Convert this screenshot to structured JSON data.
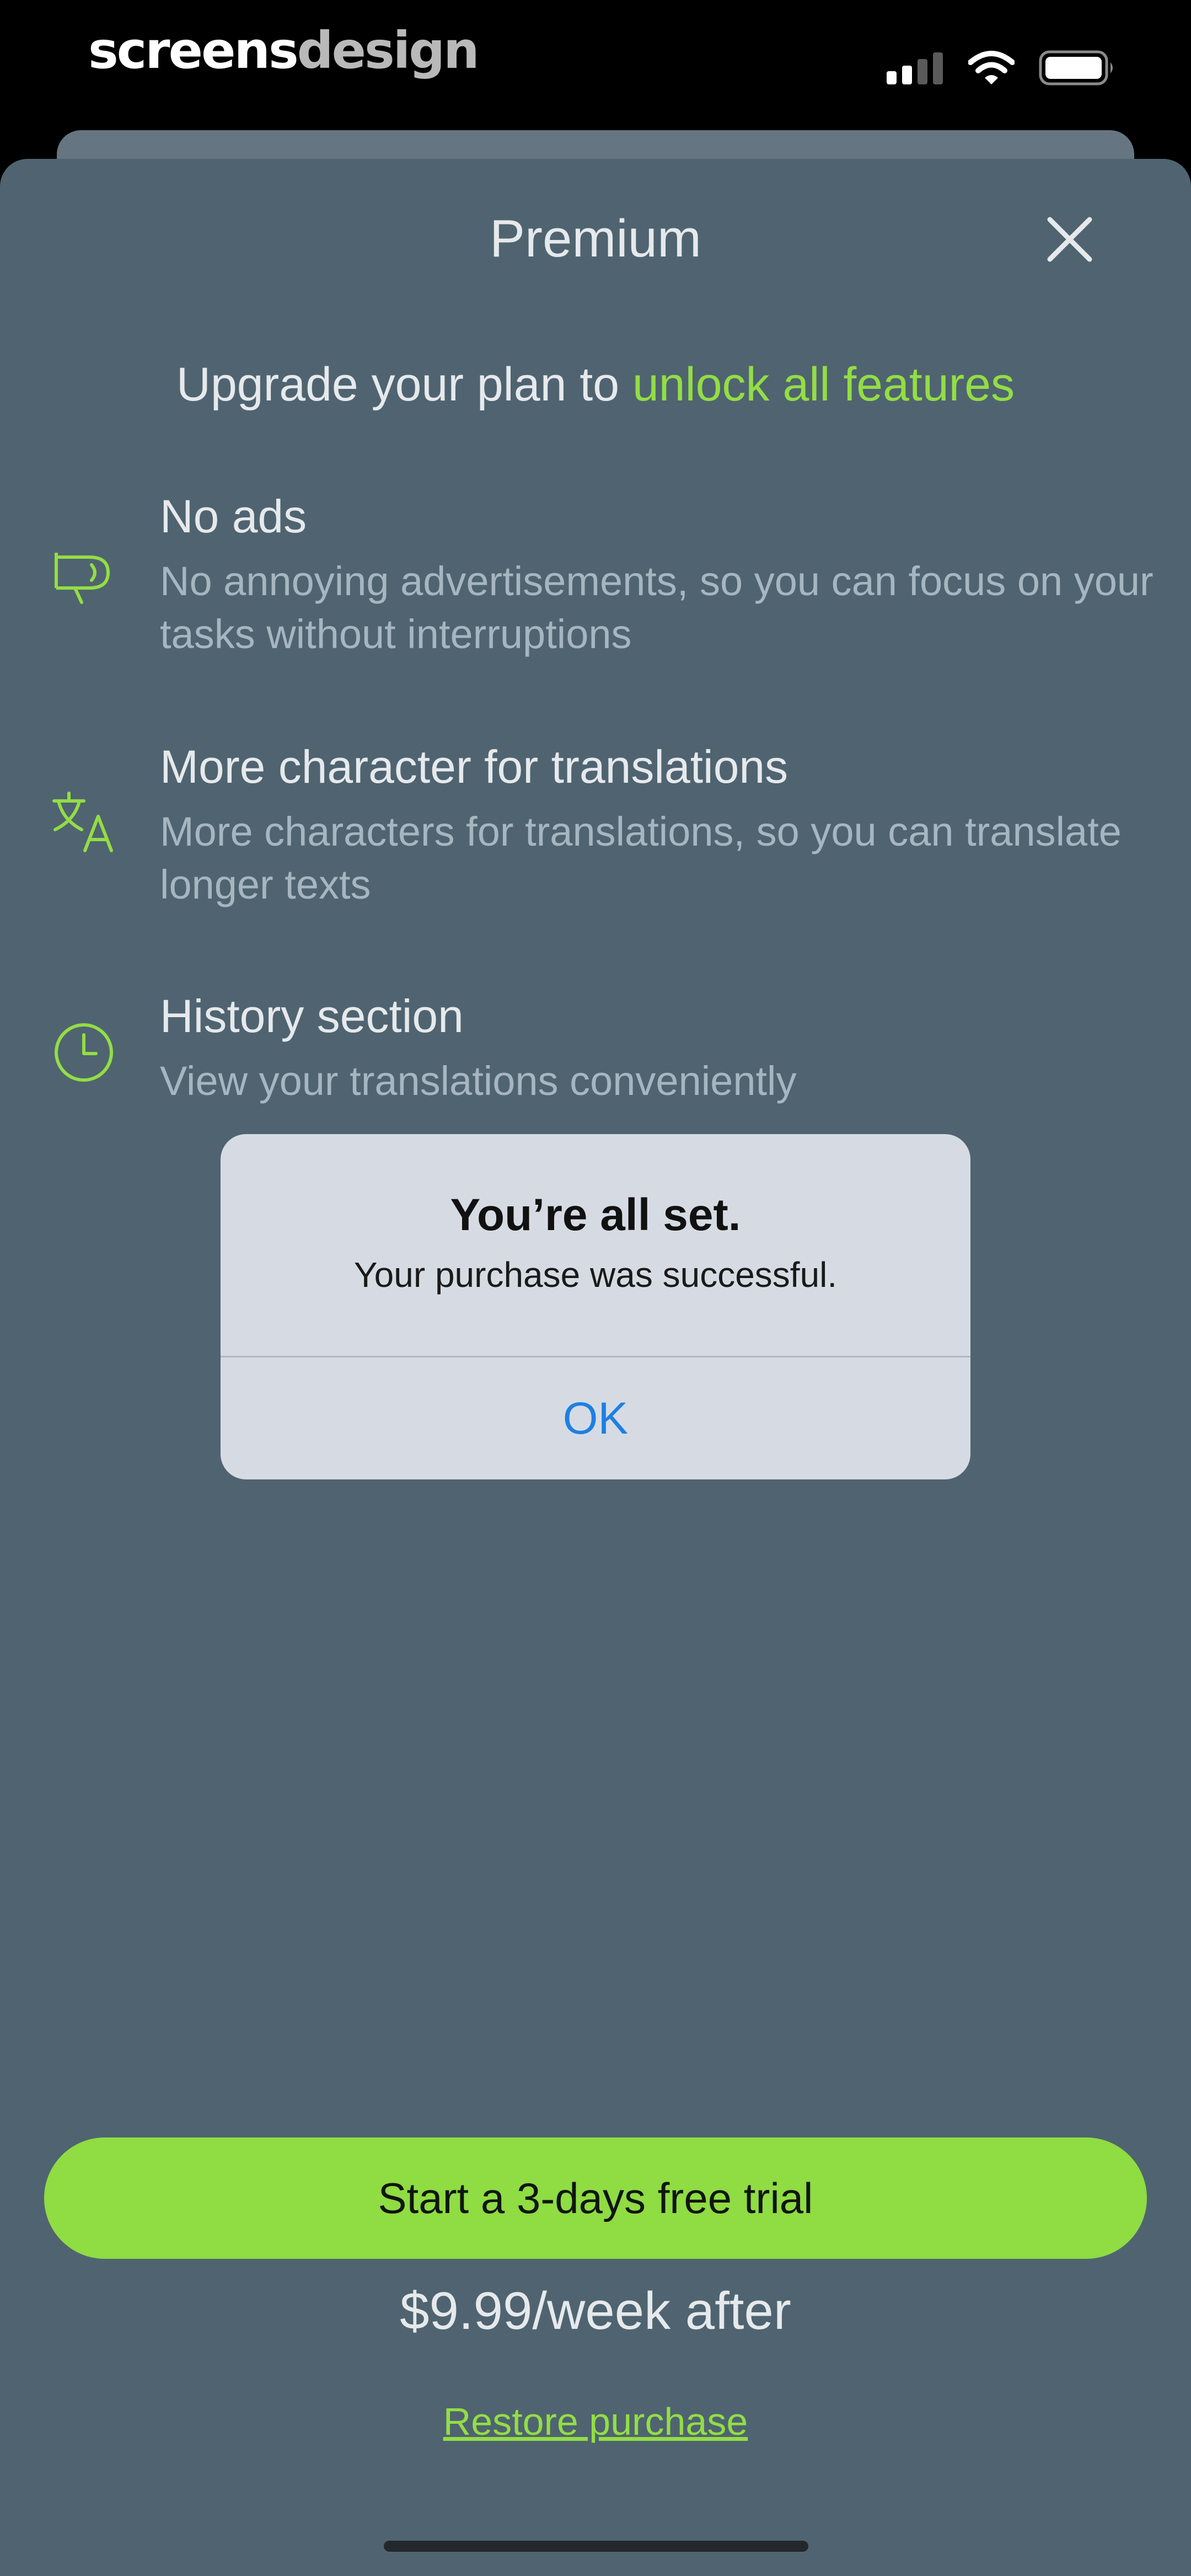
{
  "status_bar": {
    "brand_part1": "screens",
    "brand_part2": "design",
    "icons": [
      "cellular-signal-icon",
      "wifi-icon",
      "battery-icon"
    ]
  },
  "paywall": {
    "title": "Premium",
    "close_icon": "close-icon",
    "headline": {
      "text": "Upgrade your plan to ",
      "highlight": "unlock all features"
    },
    "features": [
      {
        "icon": "megaphone-icon",
        "title": "No ads",
        "description": "No annoying advertisements, so you can focus on your tasks without interruptions"
      },
      {
        "icon": "translate-icon",
        "title": "More character for translations",
        "description": "More characters for translations, so you can translate longer texts"
      },
      {
        "icon": "clock-icon",
        "title": "History section",
        "description": "View your translations conveniently"
      }
    ],
    "cta_label": "Start a 3-days free trial",
    "price_text": "$9.99/week after",
    "restore_label": "Restore purchase"
  },
  "alert": {
    "title": "You’re all set.",
    "message": "Your purchase was successful.",
    "ok_label": "OK"
  },
  "colors": {
    "sheet_background": "#4f6470",
    "accent_green": "#8fdc43",
    "alert_background": "#d6dbe3",
    "alert_button_blue": "#1f7fe2"
  }
}
